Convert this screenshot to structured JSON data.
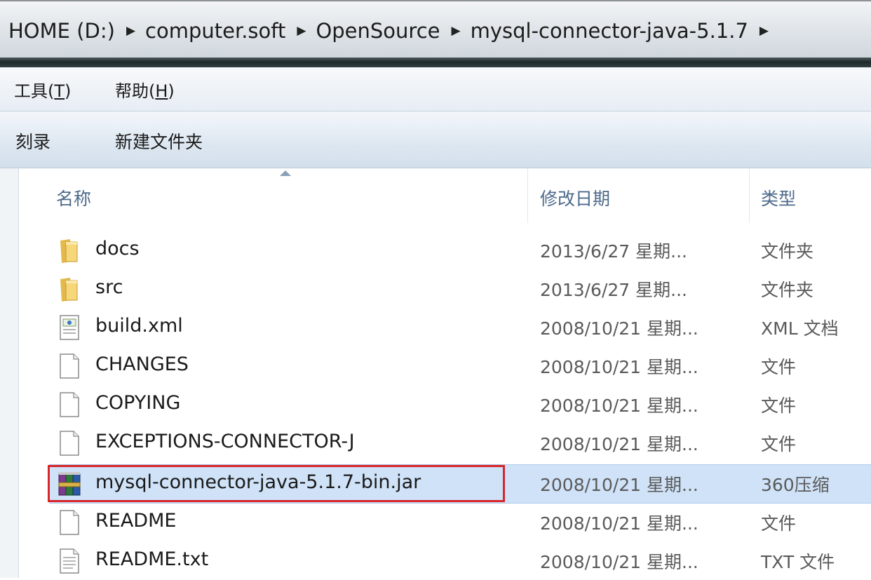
{
  "address_bar": {
    "crumbs": [
      "HOME (D:)",
      "computer.soft",
      "OpenSource",
      "mysql-connector-java-5.1.7"
    ]
  },
  "menu": {
    "tools": "工具(T)",
    "help": "帮助(H)"
  },
  "commands": {
    "burn": "刻录",
    "new_folder": "新建文件夹"
  },
  "columns": {
    "name": "名称",
    "date": "修改日期",
    "type": "类型"
  },
  "files": [
    {
      "name": "docs",
      "date": "2013/6/27 星期...",
      "type": "文件夹",
      "icon": "folder-icon"
    },
    {
      "name": "src",
      "date": "2013/6/27 星期...",
      "type": "文件夹",
      "icon": "folder-icon"
    },
    {
      "name": "build.xml",
      "date": "2008/10/21 星期...",
      "type": "XML 文档",
      "icon": "xml-file-icon"
    },
    {
      "name": "CHANGES",
      "date": "2008/10/21 星期...",
      "type": "文件",
      "icon": "file-icon"
    },
    {
      "name": "COPYING",
      "date": "2008/10/21 星期...",
      "type": "文件",
      "icon": "file-icon"
    },
    {
      "name": "EXCEPTIONS-CONNECTOR-J",
      "date": "2008/10/21 星期...",
      "type": "文件",
      "icon": "file-icon"
    },
    {
      "name": "mysql-connector-java-5.1.7-bin.jar",
      "date": "2008/10/21 星期...",
      "type": "360压缩",
      "icon": "archive-icon",
      "selected": true
    },
    {
      "name": "README",
      "date": "2008/10/21 星期...",
      "type": "文件",
      "icon": "file-icon"
    },
    {
      "name": "README.txt",
      "date": "2008/10/21 星期...",
      "type": "TXT 文件",
      "icon": "text-file-icon"
    }
  ],
  "colors": {
    "highlight": "#cfe2f7",
    "red_outline": "#d8262b",
    "header_text": "#4e6a8b"
  }
}
